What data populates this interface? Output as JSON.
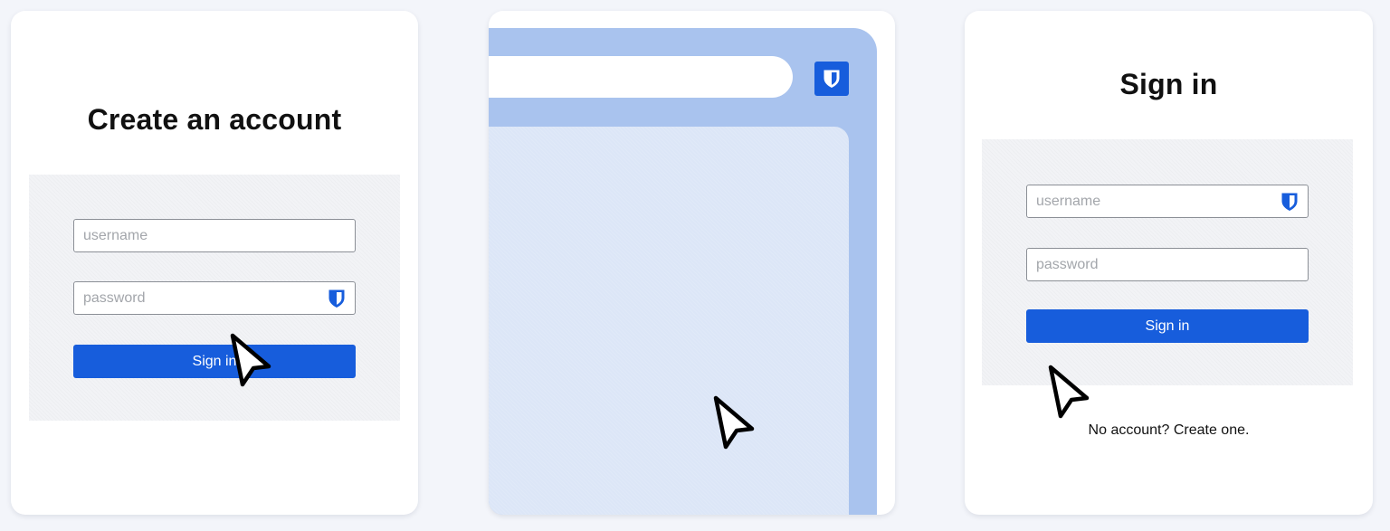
{
  "create_account": {
    "title": "Create an account",
    "username_placeholder": "username",
    "password_placeholder": "password",
    "submit_label": "Sign in"
  },
  "sign_in": {
    "title": "Sign in",
    "username_placeholder": "username",
    "password_placeholder": "password",
    "submit_label": "Sign in",
    "footer_text": "No account? Create one."
  },
  "icons": {
    "extension": "bitwarden-shield-icon",
    "autofill": "bitwarden-shield-icon",
    "pointer": "mouse-pointer-icon"
  },
  "colors": {
    "accent": "#175ddc",
    "browser_frame": "#a9c3ee",
    "browser_viewport": "#dce6f7",
    "page_background": "#f3f5fa"
  }
}
